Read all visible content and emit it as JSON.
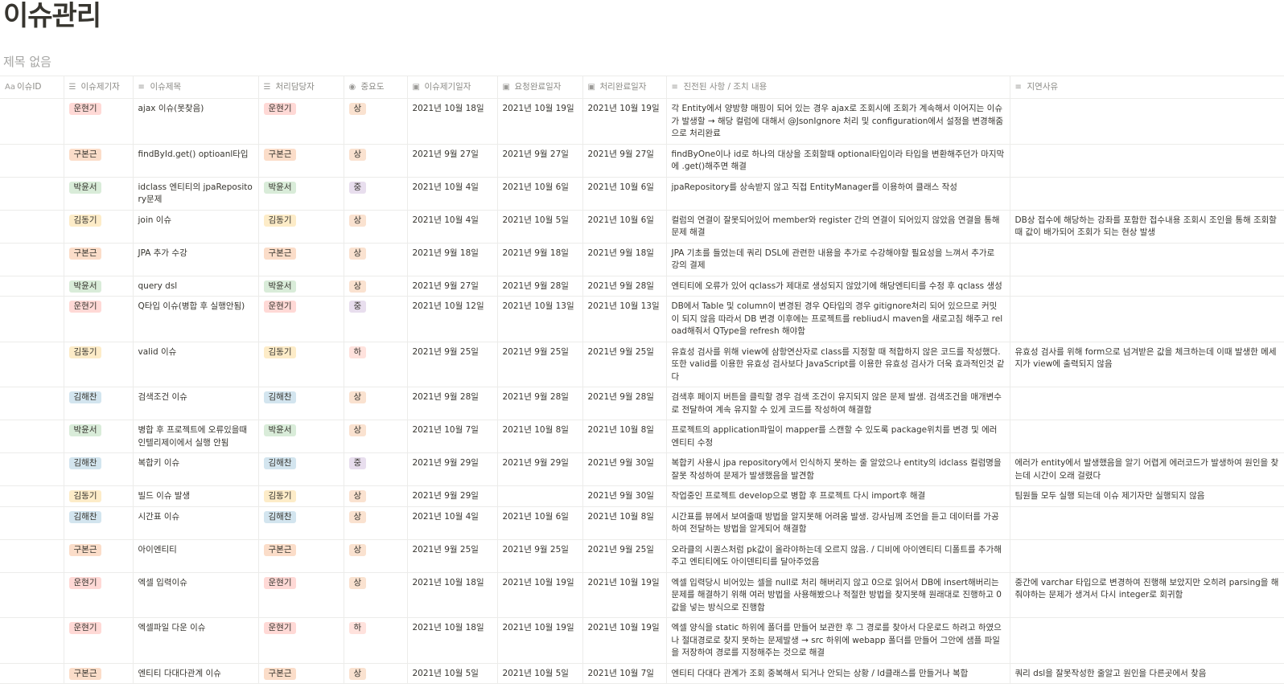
{
  "page": {
    "title": "이슈관리",
    "view_title": "제목 없음"
  },
  "colors": {
    "운현기": "red",
    "구본근": "orange",
    "박윤서": "green",
    "김동기": "yellow",
    "김해찬": "blue",
    "상": "high",
    "중": "mid",
    "하": "low"
  },
  "columns": [
    {
      "label": "이슈ID",
      "icon": "text-type-icon",
      "glyph": "Aa"
    },
    {
      "label": "이슈제기자",
      "icon": "list-icon",
      "glyph": "☰"
    },
    {
      "label": "이슈제목",
      "icon": "text-icon",
      "glyph": "≡"
    },
    {
      "label": "처리담당자",
      "icon": "list-icon",
      "glyph": "☰"
    },
    {
      "label": "중요도",
      "icon": "select-icon",
      "glyph": "◉"
    },
    {
      "label": "이슈제기일자",
      "icon": "calendar-icon",
      "glyph": "▣"
    },
    {
      "label": "요청완료일자",
      "icon": "calendar-icon",
      "glyph": "▣"
    },
    {
      "label": "처리완료일자",
      "icon": "calendar-icon",
      "glyph": "▣"
    },
    {
      "label": "진전된 사항 / 조치 내용",
      "icon": "text-icon",
      "glyph": "≡"
    },
    {
      "label": "지연사유",
      "icon": "text-icon",
      "glyph": "≡"
    }
  ],
  "rows": [
    {
      "id": "",
      "reporter": "운현기",
      "title": "ajax 이슈(못찾음)",
      "owner": "운현기",
      "priority": "상",
      "raised": "2021년 10월 18일",
      "requested": "2021년 10월 19일",
      "completed": "2021년 10월 19일",
      "progress": "각 Entity에서 양방향 매핑이 되어 있는 경우 ajax로 조회시에 조회가 계속해서 이어지는 이슈가 발생할 → 해당 컬럼에 대해서 @JsonIgnore 처리 및 configuration에서 설정을 변경해줌으로 처리완료",
      "delay": ""
    },
    {
      "id": "",
      "reporter": "구본근",
      "title": "findById.get() optioanl타입",
      "owner": "구본근",
      "priority": "상",
      "raised": "2021년 9월 27일",
      "requested": "2021년 9월 27일",
      "completed": "2021년 9월 27일",
      "progress": "findByOne이나 id로 하나의 대상을 조회할때 optional타입이라 타입을 변환해주던가 마지막에 .get()해주면 해결",
      "delay": ""
    },
    {
      "id": "",
      "reporter": "박윤서",
      "title": "idclass 엔티티의 jpaRepository문제",
      "owner": "박윤서",
      "priority": "중",
      "raised": "2021년 10월 4일",
      "requested": "2021년 10월 6일",
      "completed": "2021년 10월 6일",
      "progress": "jpaRepository를 상속받지 않고 직접 EntityManager를 이용하여 클래스 작성",
      "delay": ""
    },
    {
      "id": "",
      "reporter": "김동기",
      "title": "join 이슈",
      "owner": "김동기",
      "priority": "상",
      "raised": "2021년 10월 4일",
      "requested": "2021년 10월 5일",
      "completed": "2021년 10월 6일",
      "progress": "컬럼의 연결이 잘못되어있어 member와 register 간의 연결이 되어있지 않았음 연결을 통해 문제 해결",
      "delay": "DB상 접수에 해당하는 강좌를 포함한 접수내용 조회시 조인을 통해 조회할 때 값이 배가되어 조회가 되는 현상 발생"
    },
    {
      "id": "",
      "reporter": "구본근",
      "title": "JPA 추가 수강",
      "owner": "구본근",
      "priority": "상",
      "raised": "2021년 9월 18일",
      "requested": "2021년 9월 18일",
      "completed": "2021년 9월 18일",
      "progress": "JPA 기초를 들었는데 쿼리 DSL에 관련한 내용을 추가로 수강해야할 필요성을 느껴서 추가로 강의 결제",
      "delay": ""
    },
    {
      "id": "",
      "reporter": "박윤서",
      "title": "query dsl",
      "owner": "박윤서",
      "priority": "상",
      "raised": "2021년 9월 27일",
      "requested": "2021년 9월 28일",
      "completed": "2021년 9월 28일",
      "progress": "엔티티에 오류가 있어 qclass가 제대로 생성되지 않았기에 해당엔티티를 수정 후 qclass 생성",
      "delay": ""
    },
    {
      "id": "",
      "reporter": "운현기",
      "title": "Q타입 이슈(병합 후 실행안됨)",
      "owner": "운현기",
      "priority": "중",
      "raised": "2021년 10월 12일",
      "requested": "2021년 10월 13일",
      "completed": "2021년 10월 13일",
      "progress": "DB에서 Table 및 column이 변경된 경우 Q타입의 경우 gitignore처리 되어 있으므로 커밋이 되지 않음 따라서 DB 변경 이후에는 프로젝트를 rebliud시 maven을 새로고침 해주고 reload해줘서 QType을 refresh 해야함",
      "delay": ""
    },
    {
      "id": "",
      "reporter": "김동기",
      "title": "valid 이슈",
      "owner": "김동기",
      "priority": "하",
      "raised": "2021년 9월 25일",
      "requested": "2021년 9월 25일",
      "completed": "2021년 9월 25일",
      "progress": "유효성 검사를 위해 view에 삼항연산자로 class를 지정할 때 적합하지 않은 코드를 작성했다. 또한 valid를 이용한 유효성 검사보다 JavaScript를 이용한 유효성 검사가 더욱 효과적인것 같다",
      "delay": "유효성 검사를 위해 form으로 넘겨받은 값을 체크하는데 이때 발생한 메세지가 view에 출력되지 않음"
    },
    {
      "id": "",
      "reporter": "김해찬",
      "title": "검색조건 이슈",
      "owner": "김해찬",
      "priority": "상",
      "raised": "2021년 9월 28일",
      "requested": "2021년 9월 28일",
      "completed": "2021년 9월 28일",
      "progress": "검색후 페이지 버튼을 클릭할 경우 검색 조건이 유지되지 않은 문제 발생. 검색조건을 매개변수로 전달하여 계속 유지할 수 있게 코드를 작성하여 해결함",
      "delay": ""
    },
    {
      "id": "",
      "reporter": "박윤서",
      "title": "병합 후 프로젝트에 오류있을때 인텔리제이에서 실행 안됨",
      "owner": "박윤서",
      "priority": "상",
      "raised": "2021년 10월 7일",
      "requested": "2021년 10월 8일",
      "completed": "2021년 10월 8일",
      "progress": "프로젝트의 application파일이 mapper를 스캔할 수 있도록 package위치를 변경 및 에러엔티티 수정",
      "delay": ""
    },
    {
      "id": "",
      "reporter": "김해찬",
      "title": "복합키 이슈",
      "owner": "김해찬",
      "priority": "중",
      "raised": "2021년 9월 29일",
      "requested": "2021년 9월 29일",
      "completed": "2021년 9월 30일",
      "progress": "복합키 사용시 jpa repository에서 인식하지 못하는 줄 알았으나 entity의 idclass 컬럼명을 잘못 작성하여 문제가 발생했음을 발견함",
      "delay": "에러가 entity에서 발생했음을 알기 어렵게 에러코드가 발생하여 원인을 찾는데 시간이 오래 걸렸다"
    },
    {
      "id": "",
      "reporter": "김동기",
      "title": "빌드 이슈 발생",
      "owner": "김동기",
      "priority": "상",
      "raised": "2021년 9월 29일",
      "requested": "",
      "completed": "2021년 9월 30일",
      "progress": " 작업중인 프로젝트 develop으로 병합 후 프로젝트 다시 import후 해결",
      "delay": "팀원들 모두 실행 되는데 이슈 제기자만 실행되지 않음"
    },
    {
      "id": "",
      "reporter": "김해찬",
      "title": "시간표 이슈",
      "owner": "김해찬",
      "priority": "상",
      "raised": "2021년 10월 4일",
      "requested": "2021년 10월 6일",
      "completed": "2021년 10월 8일",
      "progress": "시간표를 뷰에서 보여줄때 방법을 알지못해 어려움 발생. 강사님께 조언을 듣고 데이터를 가공하여 전달하는 방법을 알게되어 해결함",
      "delay": ""
    },
    {
      "id": "",
      "reporter": "구본근",
      "title": "아이엔티티",
      "owner": "구본근",
      "priority": "상",
      "raised": "2021년 9월 25일",
      "requested": "2021년 9월 25일",
      "completed": "2021년 9월 25일",
      "progress": "오라클의 시퀀스처럼 pk값이 올라야하는데 오르지 않음. / 디비에 아이엔티티 디폴트를 추가해주고 엔티티에도 아이덴티티를 달아주었음",
      "delay": ""
    },
    {
      "id": "",
      "reporter": "운현기",
      "title": "엑셀 입력이슈",
      "owner": "운현기",
      "priority": "상",
      "raised": "2021년 10월 18일",
      "requested": "2021년 10월 19일",
      "completed": "2021년 10월 19일",
      "progress": "엑셀 입력당시 비어있는 셀을 null로 처리 해버리지 않고 0으로 읽어서 DB에 insert해버리는 문제를 해결하기 위해 여러 방법을 사용해봤으나 적절한 방법을 찾지못해 원래대로 진행하고 0값을 넣는 방식으로 진행함",
      "delay": "중간에 varchar 타입으로 변경하여 진행해 보았지만 오히려 parsing을 해줘야하는 문제가 생겨서 다시 integer로 회귀함"
    },
    {
      "id": "",
      "reporter": "운현기",
      "title": "엑셀파일 다운 이슈",
      "owner": "운현기",
      "priority": "하",
      "raised": "2021년 10월 18일",
      "requested": "2021년 10월 19일",
      "completed": "2021년 10월 19일",
      "progress": "엑셀 양식을 static 하위에 폴더를 만들어 보관한 후 그 경로를 찾아서 다운로드 하려고 하였으나 절대경로로 찾지 못하는 문제발생 → src 하위에 webapp 폴더를 만들어 그안에 샘플 파일을 저장하여 경로를 지정해주는 것으로 해결",
      "delay": ""
    },
    {
      "id": "",
      "reporter": "구본근",
      "title": "엔티티 다대다관계 이슈",
      "owner": "구본근",
      "priority": "상",
      "raised": "2021년 10월 5일",
      "requested": "2021년 10월 5일",
      "completed": "2021년 10월 7일",
      "progress": "엔티티 다대다 관계가 조회 중복해서 되거나 안되는 상황 / Id클래스를 만들거나 복합",
      "delay": "쿼리 dsl을 잘못작성한 줄알고 원인을 다른곳에서 찾음"
    }
  ]
}
